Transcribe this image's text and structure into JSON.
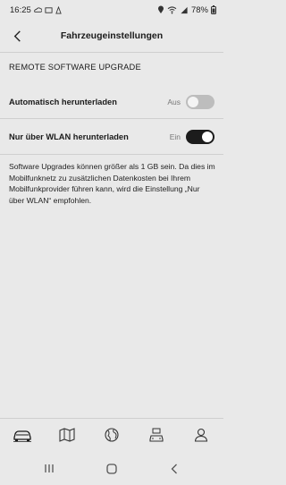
{
  "status_bar": {
    "time": "16:25",
    "battery": "78%"
  },
  "header": {
    "title": "Fahrzeugeinstellungen"
  },
  "section": {
    "title": "REMOTE SOFTWARE UPGRADE"
  },
  "settings": [
    {
      "label": "Automatisch herunterladen",
      "state_label": "Aus",
      "enabled": false
    },
    {
      "label": "Nur über WLAN herunterladen",
      "state_label": "Ein",
      "enabled": true
    }
  ],
  "description": "Software Upgrades können größer als 1 GB sein. Da dies im Mobilfunknetz zu zusätzlichen Datenkosten bei Ihrem Mobilfunkprovider führen kann, wird die Einstellung „Nur über WLAN“ empfohlen.",
  "tabs": [
    {
      "icon": "car-icon",
      "active": true
    },
    {
      "icon": "map-icon",
      "active": false
    },
    {
      "icon": "globe-icon",
      "active": false
    },
    {
      "icon": "car-service-icon",
      "active": false
    },
    {
      "icon": "profile-icon",
      "active": false
    }
  ],
  "system_nav": [
    "recents-icon",
    "home-icon",
    "back-icon"
  ]
}
